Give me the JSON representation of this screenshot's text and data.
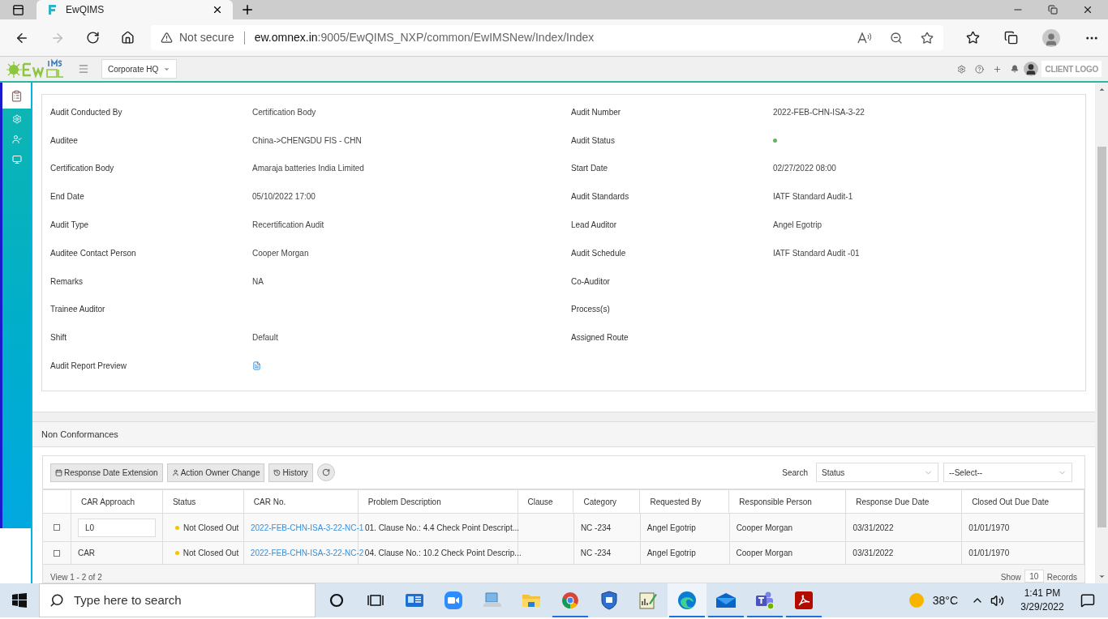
{
  "browser": {
    "tab_title": "EwQIMS",
    "security": "Not secure",
    "url_host": "ew.omnex.in",
    "url_rest": ":9005/EwQIMS_NXP/common/EwIMSNew/Index/Index"
  },
  "app_header": {
    "site": "Corporate HQ",
    "client_logo": "CLIENT LOGO"
  },
  "sidebar": {
    "items": [
      {
        "kind": "report",
        "selected": true
      },
      {
        "kind": "settings",
        "selected": false
      },
      {
        "kind": "user-check",
        "selected": false
      },
      {
        "kind": "monitor",
        "selected": false
      }
    ]
  },
  "details": {
    "fields": [
      {
        "label": "Audit Conducted By",
        "kind": "text",
        "value": "Certification Body"
      },
      {
        "label": "Audit Number",
        "kind": "text",
        "value": "2022-FEB-CHN-ISA-3-22"
      },
      {
        "label": "Auditee",
        "kind": "text",
        "value": "China->CHENGDU FIS - CHN"
      },
      {
        "label": "Audit Status",
        "kind": "status",
        "color": "#5cb85c"
      },
      {
        "label": "Certification Body",
        "kind": "text",
        "value": "Amaraja batteries India Limited"
      },
      {
        "label": "Start Date",
        "kind": "text",
        "value": "02/27/2022 08:00"
      },
      {
        "label": "End Date",
        "kind": "text",
        "value": "05/10/2022 17:00"
      },
      {
        "label": "Audit Standards",
        "kind": "text",
        "value": "IATF Standard Audit-1"
      },
      {
        "label": "Audit Type",
        "kind": "text",
        "value": "Recertification Audit"
      },
      {
        "label": "Lead Auditor",
        "kind": "text",
        "value": "Angel Egotrip"
      },
      {
        "label": "Auditee Contact Person",
        "kind": "text",
        "value": "Cooper Morgan"
      },
      {
        "label": "Audit Schedule",
        "kind": "text",
        "value": "IATF Standard Audit -01"
      },
      {
        "label": "Remarks",
        "kind": "text",
        "value": "NA"
      },
      {
        "label": "Co-Auditor",
        "kind": "blank"
      },
      {
        "label": "Trainee Auditor",
        "kind": "blank"
      },
      {
        "label": "Process(s)",
        "kind": "blank"
      },
      {
        "label": "Shift",
        "kind": "text",
        "value": "Default"
      },
      {
        "label": "Assigned Route",
        "kind": "blank"
      },
      {
        "label": "Audit Report Preview",
        "kind": "file"
      }
    ]
  },
  "non_conformances": {
    "title": "Non Conformances",
    "toolbar": [
      {
        "kind": "calendar",
        "label": "Response Date Extension"
      },
      {
        "kind": "user",
        "label": "Action Owner Change"
      },
      {
        "kind": "history",
        "label": "History"
      },
      {
        "kind": "refresh"
      }
    ],
    "search_label": "Search",
    "search_field": "Status",
    "search_value": "--Select--",
    "columns": [
      "CAR Approach",
      "Status",
      "CAR No.",
      "Problem Description",
      "Clause",
      "Category",
      "Requested By",
      "Responsible Person",
      "Response Due Date",
      "Closed Out Due Date"
    ],
    "rows": [
      {
        "checked": false,
        "car_approach": {
          "kind": "input",
          "value": "L0"
        },
        "status": "Not Closed Out",
        "color": "#f5c400",
        "car_no": "2022-FEB-CHN-ISA-3-22-NC-1",
        "problem": "01. Clause No.: 4.4 Check Point Descript...",
        "category": "NC -234",
        "requested_by": "Angel Egotrip",
        "responsible": "Cooper Morgan",
        "response_due": "03/31/2022",
        "closed_due": "01/01/1970"
      },
      {
        "checked": false,
        "car_approach": {
          "kind": "text",
          "value": "CAR"
        },
        "status": "Not Closed Out",
        "color": "#f5c400",
        "car_no": "2022-FEB-CHN-ISA-3-22-NC-2",
        "problem": "04. Clause No.: 10.2 Check Point Descrip...",
        "category": "NC -234",
        "requested_by": "Angel Egotrip",
        "responsible": "Cooper Morgan",
        "response_due": "03/31/2022",
        "closed_due": "01/01/1970"
      }
    ],
    "pager": "View 1 - 2 of 2",
    "show_label": "Show",
    "page_size": "10",
    "records_label": "Records"
  },
  "taskbar": {
    "search_placeholder": "Type here to search",
    "apps": [
      {
        "kind": "cortana",
        "running": false,
        "selected": false
      },
      {
        "kind": "taskview",
        "running": false,
        "selected": false
      },
      {
        "kind": "news",
        "running": false,
        "selected": false
      },
      {
        "kind": "video",
        "running": false,
        "selected": false
      },
      {
        "kind": "computer",
        "running": false,
        "selected": false
      },
      {
        "kind": "folder",
        "running": false,
        "selected": false
      },
      {
        "kind": "chrome",
        "running": true,
        "selected": false
      },
      {
        "kind": "shield",
        "running": false,
        "selected": false
      },
      {
        "kind": "notepad",
        "running": false,
        "selected": false
      },
      {
        "kind": "edge",
        "running": true,
        "selected": true
      },
      {
        "kind": "mail",
        "running": true,
        "selected": false
      },
      {
        "kind": "people",
        "running": true,
        "selected": false
      },
      {
        "kind": "pdf",
        "running": true,
        "selected": false
      }
    ],
    "temperature": "38°C",
    "time": "1:41 PM",
    "date": "3/29/2022"
  }
}
